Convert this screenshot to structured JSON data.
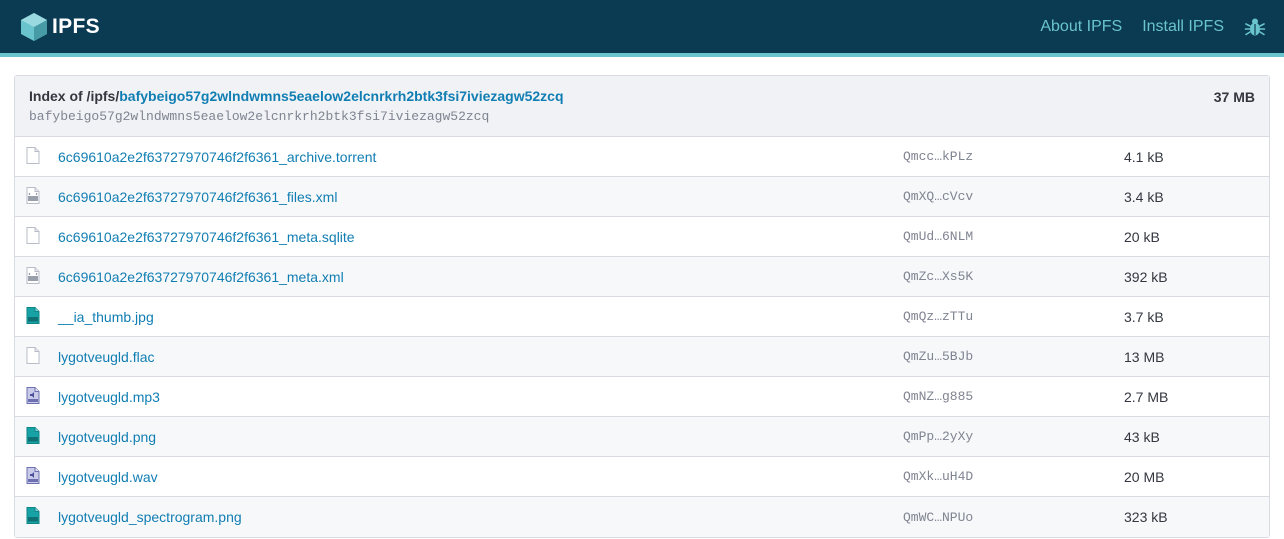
{
  "header": {
    "logo_text": "IPFS",
    "nav": [
      {
        "label": "About IPFS"
      },
      {
        "label": "Install IPFS"
      }
    ],
    "icon_bug": "bug-icon"
  },
  "index": {
    "prefix": "Index of /ipfs/",
    "cid": "bafybeigo57g2wlndwmns5eaelow2elcnrkrh2btk3fsi7iviezagw52zcq",
    "cid_sub": "bafybeigo57g2wlndwmns5eaelow2elcnrkrh2btk3fsi7iviezagw52zcq",
    "total_size": "37 MB"
  },
  "colors": {
    "topbar": "#0b3a53",
    "accent": "#69c4cd",
    "link": "#117eb3"
  },
  "files": [
    {
      "name": "6c69610a2e2f63727970746f2f6361_archive.torrent",
      "hash": "Qmcc…kPLz",
      "size": "4.1 kB",
      "icon": "blank-file-icon"
    },
    {
      "name": "6c69610a2e2f63727970746f2f6361_files.xml",
      "hash": "QmXQ…cVcv",
      "size": "3.4 kB",
      "icon": "xml-file-icon"
    },
    {
      "name": "6c69610a2e2f63727970746f2f6361_meta.sqlite",
      "hash": "QmUd…6NLM",
      "size": "20 kB",
      "icon": "blank-file-icon"
    },
    {
      "name": "6c69610a2e2f63727970746f2f6361_meta.xml",
      "hash": "QmZc…Xs5K",
      "size": "392 kB",
      "icon": "xml-file-icon"
    },
    {
      "name": "__ia_thumb.jpg",
      "hash": "QmQz…zTTu",
      "size": "3.7 kB",
      "icon": "image-file-icon"
    },
    {
      "name": "lygotveugld.flac",
      "hash": "QmZu…5BJb",
      "size": "13 MB",
      "icon": "blank-file-icon"
    },
    {
      "name": "lygotveugld.mp3",
      "hash": "QmNZ…g885",
      "size": "2.7 MB",
      "icon": "audio-file-icon"
    },
    {
      "name": "lygotveugld.png",
      "hash": "QmPp…2yXy",
      "size": "43 kB",
      "icon": "image-file-icon"
    },
    {
      "name": "lygotveugld.wav",
      "hash": "QmXk…uH4D",
      "size": "20 MB",
      "icon": "audio-file-icon"
    },
    {
      "name": "lygotveugld_spectrogram.png",
      "hash": "QmWC…NPUo",
      "size": "323 kB",
      "icon": "image-file-icon"
    }
  ]
}
